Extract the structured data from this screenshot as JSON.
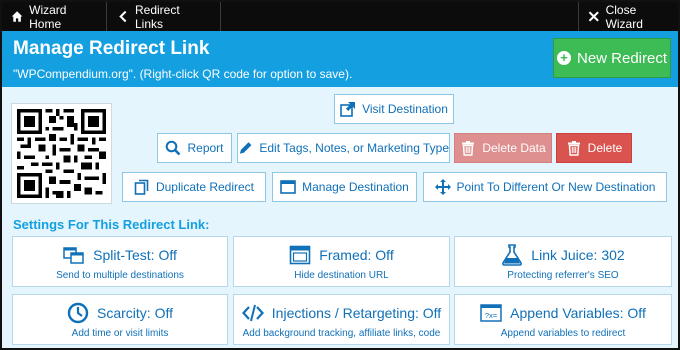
{
  "nav": {
    "home_label": "Wizard Home",
    "redirects_label": "Redirect Links",
    "close_label": "Close Wizard"
  },
  "header": {
    "title": "Manage Redirect Link",
    "subtitle": "\"WPCompendium.org\". (Right-click QR code for option to save).",
    "new_redirect_label": "New Redirect"
  },
  "actions": {
    "visit": "Visit Destination",
    "report": "Report",
    "edit": "Edit Tags, Notes, or Marketing Type",
    "delete_data": "Delete Data",
    "delete": "Delete",
    "duplicate": "Duplicate Redirect",
    "manage": "Manage Destination",
    "point": "Point To Different Or New Destination"
  },
  "settings": {
    "heading": "Settings For This Redirect Link:",
    "cards": [
      {
        "title": "Split-Test: Off",
        "desc": "Send to multiple destinations",
        "icon": "split-test-icon"
      },
      {
        "title": "Framed: Off",
        "desc": "Hide destination URL",
        "icon": "framed-window-icon"
      },
      {
        "title": "Link Juice: 302",
        "desc": "Protecting referrer's SEO",
        "icon": "flask-icon"
      },
      {
        "title": "Scarcity: Off",
        "desc": "Add time or visit limits",
        "icon": "clock-icon"
      },
      {
        "title": "Injections / Retargeting: Off",
        "desc": "Add background tracking, affiliate links, code",
        "icon": "code-icon"
      },
      {
        "title": "Append Variables: Off",
        "desc": "Append variables to redirect",
        "icon": "variables-icon"
      }
    ]
  },
  "colors": {
    "accent": "#139fe0",
    "nav_bg": "#0c0c0c",
    "success": "#3dbb54",
    "danger": "#d9534f",
    "danger_muted": "#de8f8f",
    "link": "#1070b8",
    "panel_bg": "#e5f5fd"
  }
}
